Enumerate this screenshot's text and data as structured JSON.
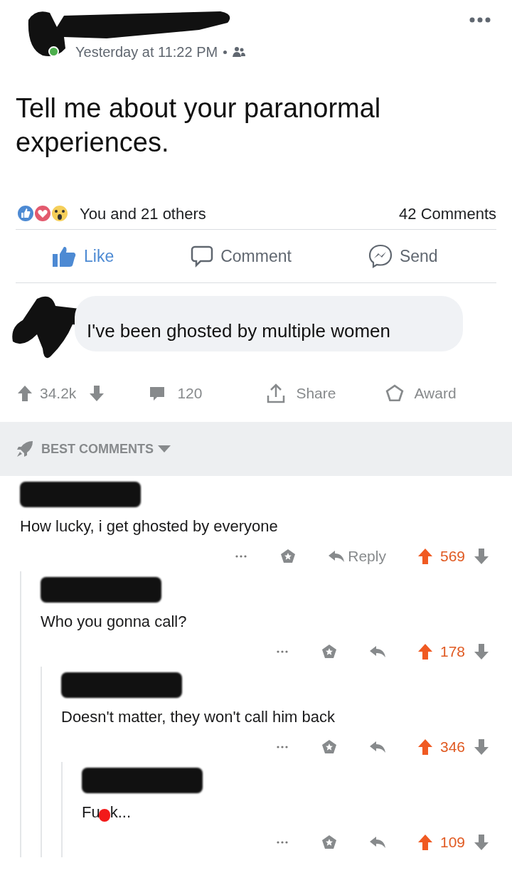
{
  "post": {
    "online": true,
    "time": "Yesterday at 11:22 PM",
    "text": "Tell me about your paranormal experiences.",
    "reactions": "You and 21 others",
    "comments_count": "42 Comments",
    "actions": [
      {
        "kind": "like",
        "label": "Like",
        "selected": true
      },
      {
        "kind": "comment",
        "label": "Comment",
        "selected": false
      },
      {
        "kind": "send",
        "label": "Send",
        "selected": false
      }
    ]
  },
  "reply": {
    "text": "I've been ghosted by multiple women"
  },
  "reddit_bar": {
    "score": "34.2k",
    "comments": "120",
    "share": "Share",
    "award": "Award"
  },
  "sort": {
    "label": "BEST COMMENTS"
  },
  "comments": [
    {
      "text": "How lucky, i get ghosted by everyone",
      "reply_label": "Reply",
      "score": "569",
      "upvoted": true,
      "children": [
        {
          "text": "Who you gonna call?",
          "score": "178",
          "upvoted": true,
          "children": [
            {
              "text": "Doesn't matter, they won't call him back",
              "score": "346",
              "upvoted": true,
              "children": [
                {
                  "text": "Fu",
                  "censored_tail": "k...",
                  "score": "109",
                  "upvoted": true
                }
              ]
            }
          ]
        }
      ]
    }
  ]
}
